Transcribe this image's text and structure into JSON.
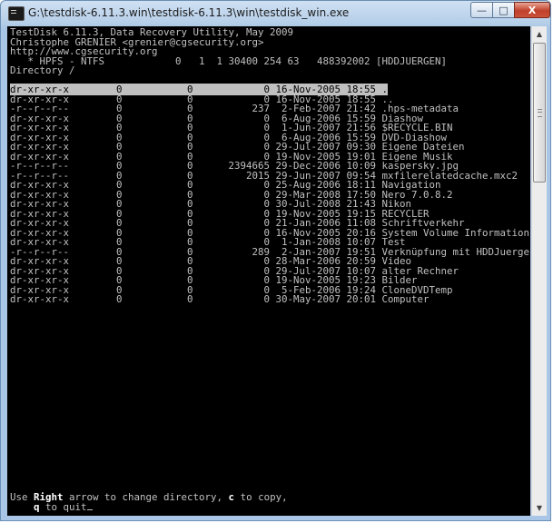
{
  "window": {
    "title": "G:\\testdisk-6.11.3.win\\testdisk-6.11.3\\win\\testdisk_win.exe",
    "buttons": {
      "minimize": "—",
      "maximize": "□",
      "close": "X"
    }
  },
  "header": [
    "TestDisk 6.11.3, Data Recovery Utility, May 2009",
    "Christophe GRENIER <grenier@cgsecurity.org>",
    "http://www.cgsecurity.org",
    "   * HPFS - NTFS            0   1  1 30400 254 63   488392002 [HDDJUERGEN]",
    "Directory /"
  ],
  "entries": [
    {
      "perms": "dr-xr-xr-x",
      "uid": "0",
      "gid": "0",
      "size": "0",
      "date": "16-Nov-2005",
      "time": "18:55",
      "name": ".",
      "selected": true
    },
    {
      "perms": "dr-xr-xr-x",
      "uid": "0",
      "gid": "0",
      "size": "0",
      "date": "16-Nov-2005",
      "time": "18:55",
      "name": ".."
    },
    {
      "perms": "-r--r--r--",
      "uid": "0",
      "gid": "0",
      "size": "237",
      "date": "2-Feb-2007",
      "time": "21:42",
      "name": ".hps-metadata"
    },
    {
      "perms": "dr-xr-xr-x",
      "uid": "0",
      "gid": "0",
      "size": "0",
      "date": "6-Aug-2006",
      "time": "15:59",
      "name": "Diashow"
    },
    {
      "perms": "dr-xr-xr-x",
      "uid": "0",
      "gid": "0",
      "size": "0",
      "date": "1-Jun-2007",
      "time": "21:56",
      "name": "$RECYCLE.BIN"
    },
    {
      "perms": "dr-xr-xr-x",
      "uid": "0",
      "gid": "0",
      "size": "0",
      "date": "6-Aug-2006",
      "time": "15:59",
      "name": "DVD-Diashow"
    },
    {
      "perms": "dr-xr-xr-x",
      "uid": "0",
      "gid": "0",
      "size": "0",
      "date": "29-Jul-2007",
      "time": "09:30",
      "name": "Eigene Dateien"
    },
    {
      "perms": "dr-xr-xr-x",
      "uid": "0",
      "gid": "0",
      "size": "0",
      "date": "19-Nov-2005",
      "time": "19:01",
      "name": "Eigene Musik"
    },
    {
      "perms": "-r--r--r--",
      "uid": "0",
      "gid": "0",
      "size": "2394665",
      "date": "29-Dec-2006",
      "time": "10:09",
      "name": "kaspersky.jpg"
    },
    {
      "perms": "-r--r--r--",
      "uid": "0",
      "gid": "0",
      "size": "2015",
      "date": "29-Jun-2007",
      "time": "09:54",
      "name": "mxfilerelatedcache.mxc2"
    },
    {
      "perms": "dr-xr-xr-x",
      "uid": "0",
      "gid": "0",
      "size": "0",
      "date": "25-Aug-2006",
      "time": "18:11",
      "name": "Navigation"
    },
    {
      "perms": "dr-xr-xr-x",
      "uid": "0",
      "gid": "0",
      "size": "0",
      "date": "29-Mar-2008",
      "time": "17:50",
      "name": "Nero 7.0.8.2"
    },
    {
      "perms": "dr-xr-xr-x",
      "uid": "0",
      "gid": "0",
      "size": "0",
      "date": "30-Jul-2008",
      "time": "21:43",
      "name": "Nikon"
    },
    {
      "perms": "dr-xr-xr-x",
      "uid": "0",
      "gid": "0",
      "size": "0",
      "date": "19-Nov-2005",
      "time": "19:15",
      "name": "RECYCLER"
    },
    {
      "perms": "dr-xr-xr-x",
      "uid": "0",
      "gid": "0",
      "size": "0",
      "date": "21-Jan-2006",
      "time": "11:08",
      "name": "Schriftverkehr"
    },
    {
      "perms": "dr-xr-xr-x",
      "uid": "0",
      "gid": "0",
      "size": "0",
      "date": "16-Nov-2005",
      "time": "20:16",
      "name": "System Volume Information"
    },
    {
      "perms": "dr-xr-xr-x",
      "uid": "0",
      "gid": "0",
      "size": "0",
      "date": "1-Jan-2008",
      "time": "10:07",
      "name": "Test"
    },
    {
      "perms": "-r--r--r--",
      "uid": "0",
      "gid": "0",
      "size": "289",
      "date": "2-Jan-2007",
      "time": "19:51",
      "name": "Verknüpfung mit HDDJuergen (O"
    },
    {
      "perms": "dr-xr-xr-x",
      "uid": "0",
      "gid": "0",
      "size": "0",
      "date": "28-Mar-2006",
      "time": "20:59",
      "name": "Video"
    },
    {
      "perms": "dr-xr-xr-x",
      "uid": "0",
      "gid": "0",
      "size": "0",
      "date": "29-Jul-2007",
      "time": "10:07",
      "name": "alter Rechner"
    },
    {
      "perms": "dr-xr-xr-x",
      "uid": "0",
      "gid": "0",
      "size": "0",
      "date": "19-Nov-2005",
      "time": "19:23",
      "name": "Bilder"
    },
    {
      "perms": "dr-xr-xr-x",
      "uid": "0",
      "gid": "0",
      "size": "0",
      "date": "5-Feb-2006",
      "time": "19:24",
      "name": "CloneDVDTemp"
    },
    {
      "perms": "dr-xr-xr-x",
      "uid": "0",
      "gid": "0",
      "size": "0",
      "date": "30-May-2007",
      "time": "20:01",
      "name": "Computer"
    }
  ],
  "footer": {
    "line1": {
      "prefix": "Use ",
      "key1": "Right",
      "middle": " arrow to change directory, ",
      "key2": "c",
      "suffix": " to copy,"
    },
    "line2": {
      "indent": "    ",
      "key": "q",
      "suffix": " to quit"
    }
  },
  "colors": {
    "console_bg": "#000000",
    "console_fg": "#c0c0c0",
    "highlight_bg": "#c0c0c0",
    "highlight_fg": "#000000",
    "titlebar": "#b6cfe9",
    "close_button": "#c0402a"
  },
  "icons": {
    "app": "console-app-icon",
    "scroll_up": "scroll-up-arrow-icon",
    "scroll_down": "scroll-down-arrow-icon"
  }
}
